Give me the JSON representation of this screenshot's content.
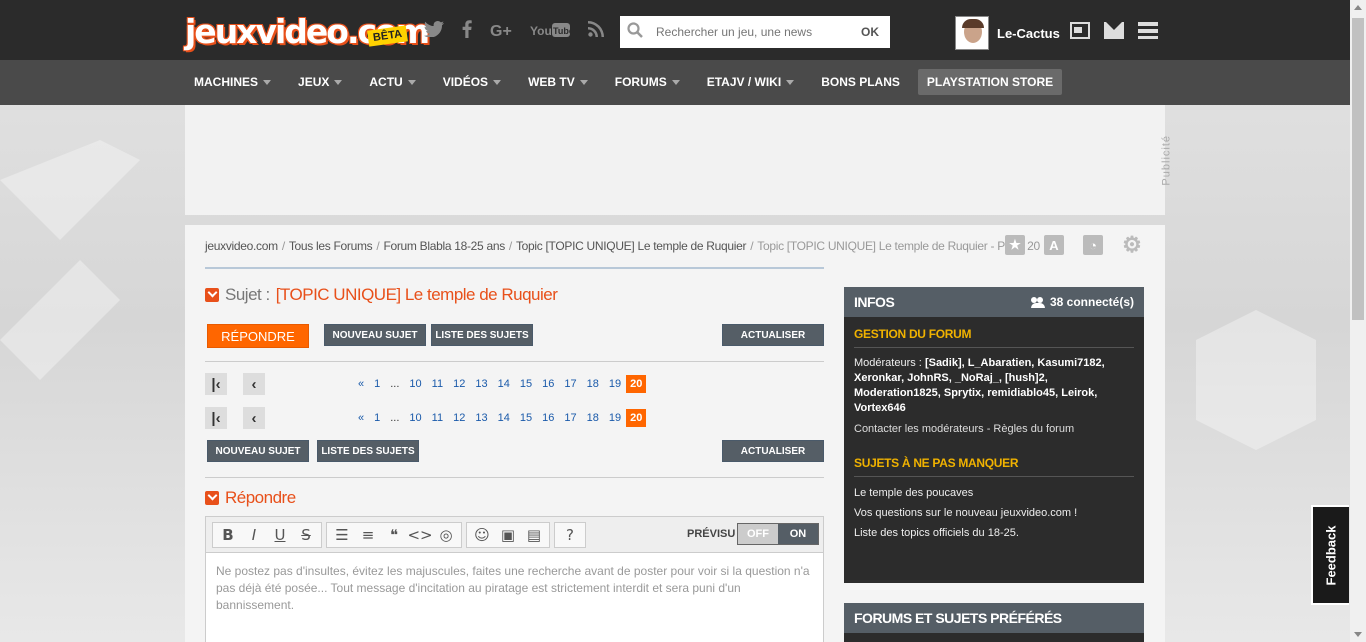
{
  "header": {
    "logo_text": "jeuxvideo.com",
    "logo_badge": "BÊTA",
    "search_placeholder": "Rechercher un jeu, une news",
    "search_button": "OK",
    "username": "Le-Cactus",
    "social_icons": [
      "twitter-icon",
      "facebook-icon",
      "google-plus-icon",
      "youtube-icon",
      "rss-icon"
    ],
    "youtube_label": "You Tube"
  },
  "nav": {
    "items": [
      {
        "label": "MACHINES",
        "caret": true
      },
      {
        "label": "JEUX",
        "caret": true
      },
      {
        "label": "ACTU",
        "caret": true
      },
      {
        "label": "VIDÉOS",
        "caret": true
      },
      {
        "label": "WEB TV",
        "caret": true
      },
      {
        "label": "FORUMS",
        "caret": true
      },
      {
        "label": "ETAJV / WIKI",
        "caret": true
      },
      {
        "label": "BONS PLANS",
        "caret": false
      },
      {
        "label": "PLAYSTATION STORE",
        "caret": false
      }
    ]
  },
  "ad": {
    "label": "Publicité"
  },
  "breadcrumb": {
    "items": [
      "jeuxvideo.com",
      "Tous les Forums",
      "Forum Blabla 18-25 ans",
      "Topic [TOPIC UNIQUE] Le temple de Ruquier"
    ],
    "separator": "/",
    "current": "Topic [TOPIC UNIQUE] Le temple de Ruquier - Page 20"
  },
  "topic": {
    "label": "Sujet :",
    "title": "[TOPIC UNIQUE] Le temple de Ruquier"
  },
  "buttons": {
    "repondre": "RÉPONDRE",
    "nouveau_sujet": "NOUVEAU SUJET",
    "liste_sujets": "LISTE DES SUJETS",
    "actualiser": "ACTUALISER"
  },
  "pagination": {
    "first": "first-page-icon",
    "prev": "prev-page-icon",
    "pages": [
      "«",
      "1",
      "...",
      "10",
      "11",
      "12",
      "13",
      "14",
      "15",
      "16",
      "17",
      "18",
      "19",
      "20"
    ],
    "current": "20"
  },
  "reply": {
    "title": "Répondre",
    "previsu_label": "PRÉVISU",
    "switch_off": "OFF",
    "switch_on": "ON",
    "placeholder": "Ne postez pas d'insultes, évitez les majuscules, faites une recherche avant de poster pour voir si la question n'a pas déjà été posée... Tout message d'incitation au piratage est strictement interdit et sera puni d'un bannissement."
  },
  "sidebar": {
    "infos_title": "INFOS",
    "connected": "38 connecté(s)",
    "gestion_title": "GESTION DU FORUM",
    "moderators_label": "Modérateurs :",
    "moderators": "[Sadik], L_Abaratien, Kasumi7182, Xeronkar, JohnRS, _NoRaj_, [hush]2, Moderation1825, Sprytix, remidiablo45, Leirok, Vortex646",
    "contact": "Contacter les modérateurs",
    "contact_sep": "-",
    "rules": "Règles du forum",
    "sujets_title": "SUJETS À NE PAS MANQUER",
    "sujets": [
      "Le temple des poucaves",
      "Vos questions sur le nouveau jeuxvideo.com !",
      "Liste des topics officiels du 18-25."
    ],
    "fav_title": "FORUMS ET SUJETS PRÉFÉRÉS"
  },
  "feedback": "Feedback",
  "colors": {
    "accent": "#ff6600",
    "dark": "#2b2b2b",
    "nav": "#4a4a4a",
    "sidebar_head": "#555e66",
    "yellow": "#f0b200"
  }
}
